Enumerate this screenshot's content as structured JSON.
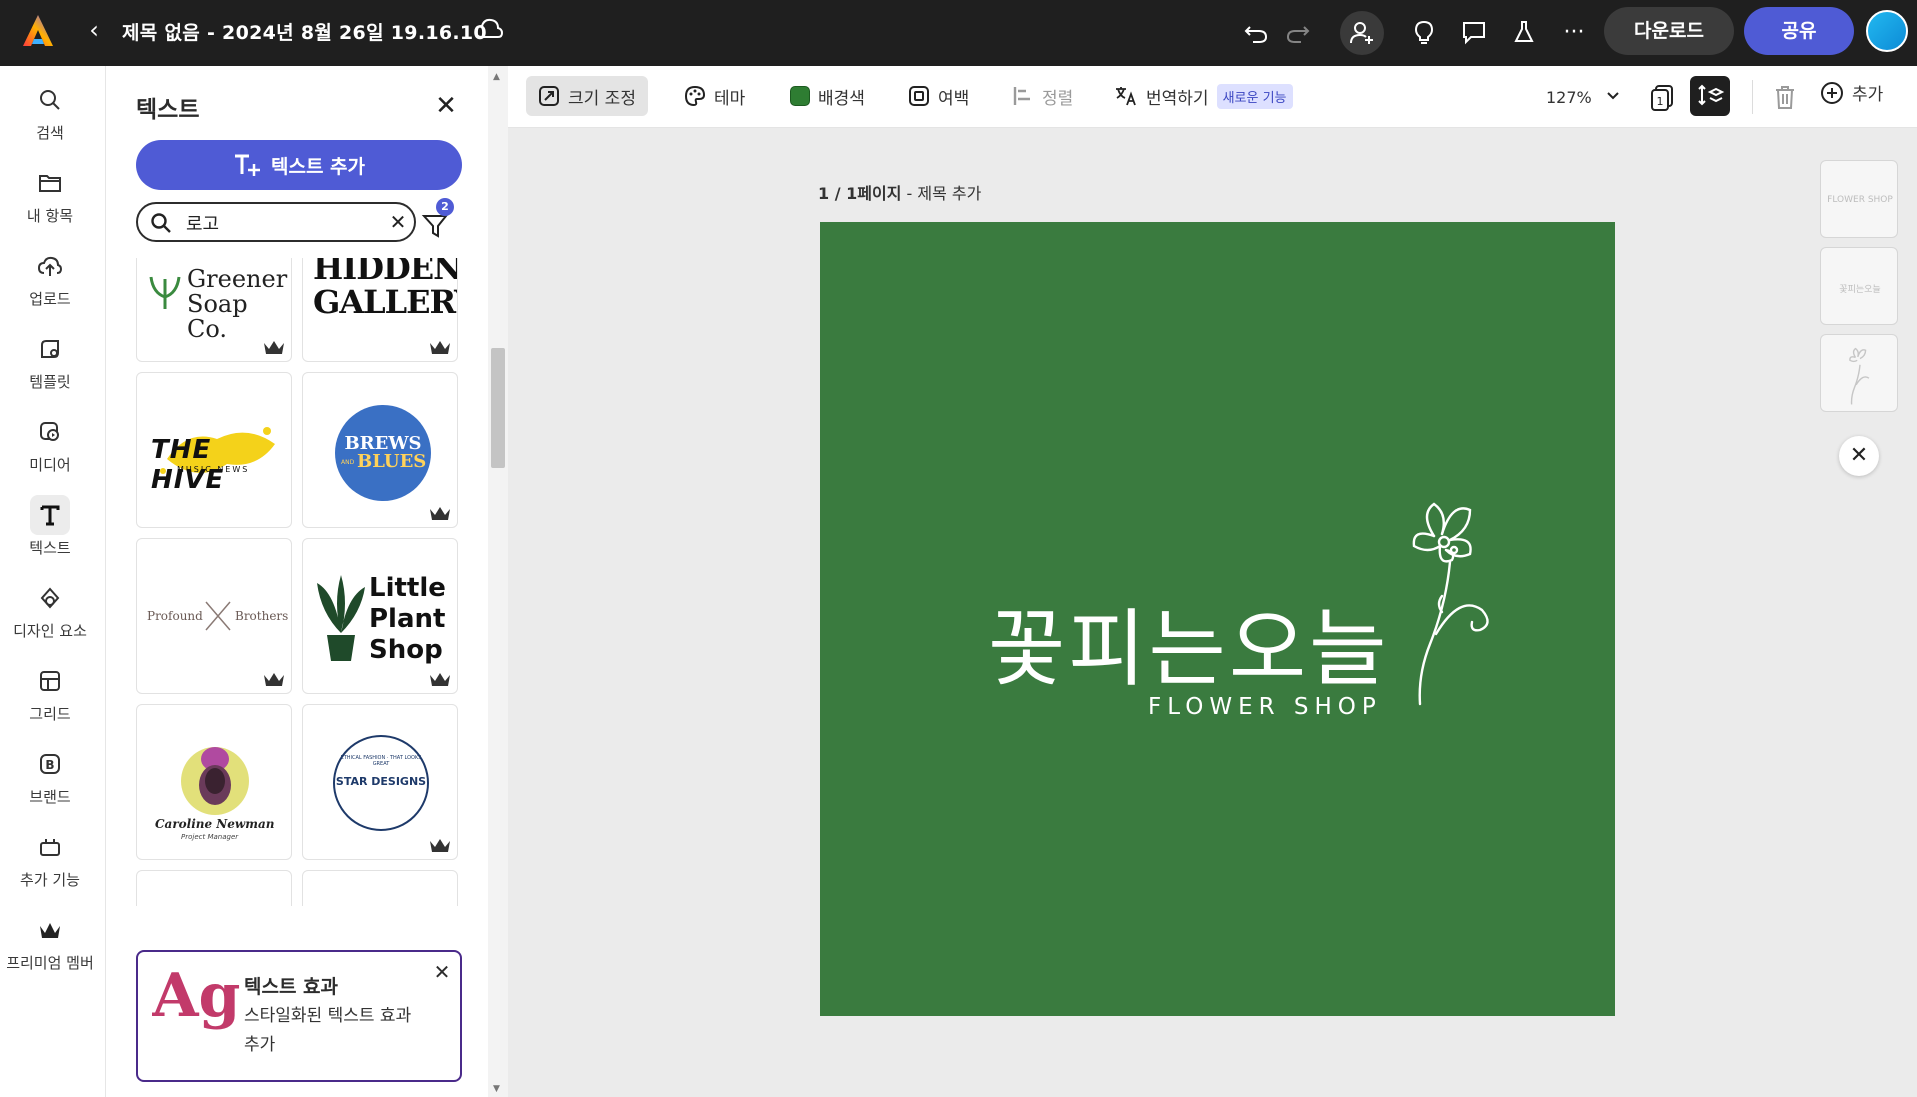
{
  "topbar": {
    "doc_title": "제목 없음 - 2024년 8월 26일 19.16.10",
    "download_label": "다운로드",
    "share_label": "공유",
    "more_label": "···"
  },
  "rail": {
    "items": [
      {
        "label": "검색",
        "icon": "search-icon"
      },
      {
        "label": "내 항목",
        "icon": "folder-icon"
      },
      {
        "label": "업로드",
        "icon": "upload-cloud-icon"
      },
      {
        "label": "템플릿",
        "icon": "template-icon"
      },
      {
        "label": "미디어",
        "icon": "media-icon"
      },
      {
        "label": "텍스트",
        "icon": "text-icon"
      },
      {
        "label": "디자인 요소",
        "icon": "shapes-icon"
      },
      {
        "label": "그리드",
        "icon": "grid-icon"
      },
      {
        "label": "브랜드",
        "icon": "brand-icon"
      },
      {
        "label": "추가 기능",
        "icon": "addons-icon"
      },
      {
        "label": "프리미엄 멤버",
        "icon": "premium-crown-icon"
      }
    ],
    "active": "텍스트"
  },
  "panel": {
    "title": "텍스트",
    "add_text_label": "텍스트 추가",
    "search_value": "로고",
    "filter_count": "2",
    "cards": [
      {
        "text": "Greener Soap Co.",
        "premium": true
      },
      {
        "text": "HIDDEN GALLERY",
        "premium": true
      },
      {
        "text": "THE HIVE",
        "sub": "MUSIC NEWS",
        "premium": false
      },
      {
        "text": "BREWS",
        "sub": "BLUES",
        "mid": "AND",
        "premium": true
      },
      {
        "text": "Profound",
        "sub": "Brothers",
        "premium": true
      },
      {
        "text": "Little Plant Shop",
        "premium": true
      },
      {
        "text": "Caroline Newman",
        "sub": "Project Manager",
        "premium": false
      },
      {
        "text": "STAR DESIGNS",
        "sub": "ETHICAL FASHION · THAT LOOKS GREAT",
        "premium": true
      }
    ],
    "effects": {
      "art_text": "Ag",
      "title": "텍스트 효과",
      "desc": "스타일화된 텍스트 효과 추가"
    }
  },
  "context_bar": {
    "resize": "크기 조정",
    "theme": "테마",
    "background": "배경색",
    "margin": "여백",
    "align": "정렬",
    "translate": "번역하기",
    "new_badge": "새로운 기능",
    "zoom": "127%",
    "add": "추가",
    "bg_color": "#2e7d32"
  },
  "canvas": {
    "page_label_bold": "1 / 1페이지",
    "page_label_rest": " - 제목 추가",
    "bg_color": "#3a7b3f",
    "logo_ko": "꽃피는오늘",
    "logo_en": "FLOWER SHOP"
  },
  "thumbs": {
    "t1": "FLOWER SHOP",
    "t2": "꽃피는오늘"
  }
}
